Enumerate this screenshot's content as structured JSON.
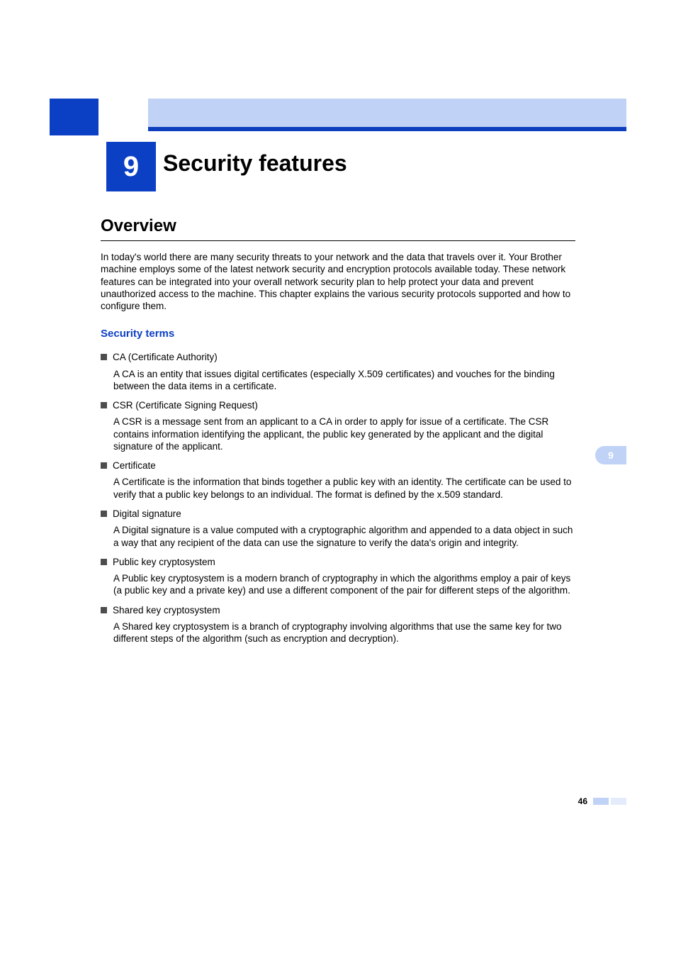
{
  "chapter": {
    "number": "9",
    "title": "Security features"
  },
  "section": {
    "heading": "Overview",
    "intro": "In today's world there are many security threats to your network and the data that travels over it. Your Brother machine employs some of the latest network security and encryption protocols available today. These network features can be integrated into your overall network security plan to help protect your data and prevent unauthorized access to the machine. This chapter explains the various security protocols supported and how to configure them."
  },
  "subsection": {
    "heading": "Security terms"
  },
  "terms": [
    {
      "title": "CA (Certificate Authority)",
      "desc": "A CA is an entity that issues digital certificates (especially X.509 certificates) and vouches for the binding between the data items in a certificate."
    },
    {
      "title": "CSR (Certificate Signing Request)",
      "desc": "A CSR is a message sent from an applicant to a CA in order to apply for issue of a certificate. The CSR contains information identifying the applicant, the public key generated by the applicant and the digital signature of the applicant."
    },
    {
      "title": "Certificate",
      "desc": "A Certificate is the information that binds together a public key with an identity. The certificate can be used to verify that a public key belongs to an individual. The format is defined by the x.509 standard."
    },
    {
      "title": "Digital signature",
      "desc": "A Digital signature is a value computed with a cryptographic algorithm and appended to a data object in such a way that any recipient of the data can use the signature to verify the data's origin and integrity."
    },
    {
      "title": "Public key cryptosystem",
      "desc": "A Public key cryptosystem is a modern branch of cryptography in which the algorithms employ a pair of keys (a public key and a private key) and use a different component of the pair for different steps of the algorithm."
    },
    {
      "title": "Shared key cryptosystem",
      "desc": "A Shared key cryptosystem is a branch of cryptography involving algorithms that use the same key for two different steps of the algorithm (such as encryption and decryption)."
    }
  ],
  "sideTab": "9",
  "pageNumber": "46"
}
